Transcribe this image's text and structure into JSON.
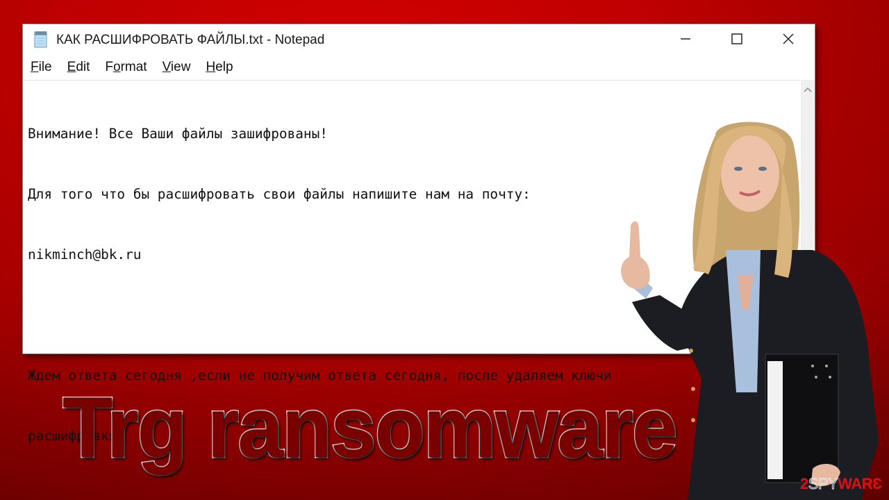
{
  "colors": {
    "background": "#c00000",
    "headline_fill": "#7a0000",
    "headline_outline": "#ffffff",
    "watermark_red": "#e01010"
  },
  "window": {
    "title": "КАК РАСШИФРОВАТЬ ФАЙЛЫ.txt - Notepad",
    "app_icon": "notepad-icon",
    "controls": {
      "minimize": "minimize-icon",
      "maximize": "maximize-icon",
      "close": "close-icon"
    },
    "menu": [
      {
        "label": "File",
        "mnemonic": "F",
        "rest": "ile"
      },
      {
        "label": "Edit",
        "mnemonic": "E",
        "rest": "dit"
      },
      {
        "label": "Format",
        "pre": "F",
        "mnemonic": "o",
        "rest": "rmat"
      },
      {
        "label": "View",
        "mnemonic": "V",
        "rest": "iew"
      },
      {
        "label": "Help",
        "mnemonic": "H",
        "rest": "elp"
      }
    ],
    "content_lines": [
      "Внимание! Все Ваши файлы зашифрованы!",
      "Для того что бы расшифровать свои файлы напишите нам на почту:",
      "nikminch@bk.ru",
      "",
      "Ждем ответа сегодня ,если не получим ответа сегодня, после удаляем ключи",
      "расшифровки."
    ],
    "scrollbar": {
      "up_arrow": "chevron-up-icon"
    }
  },
  "headline": "Trg ransomware",
  "watermark": {
    "part1": "2",
    "part2": "SPY",
    "part3": "WAR",
    "part4": "Ɛ"
  }
}
